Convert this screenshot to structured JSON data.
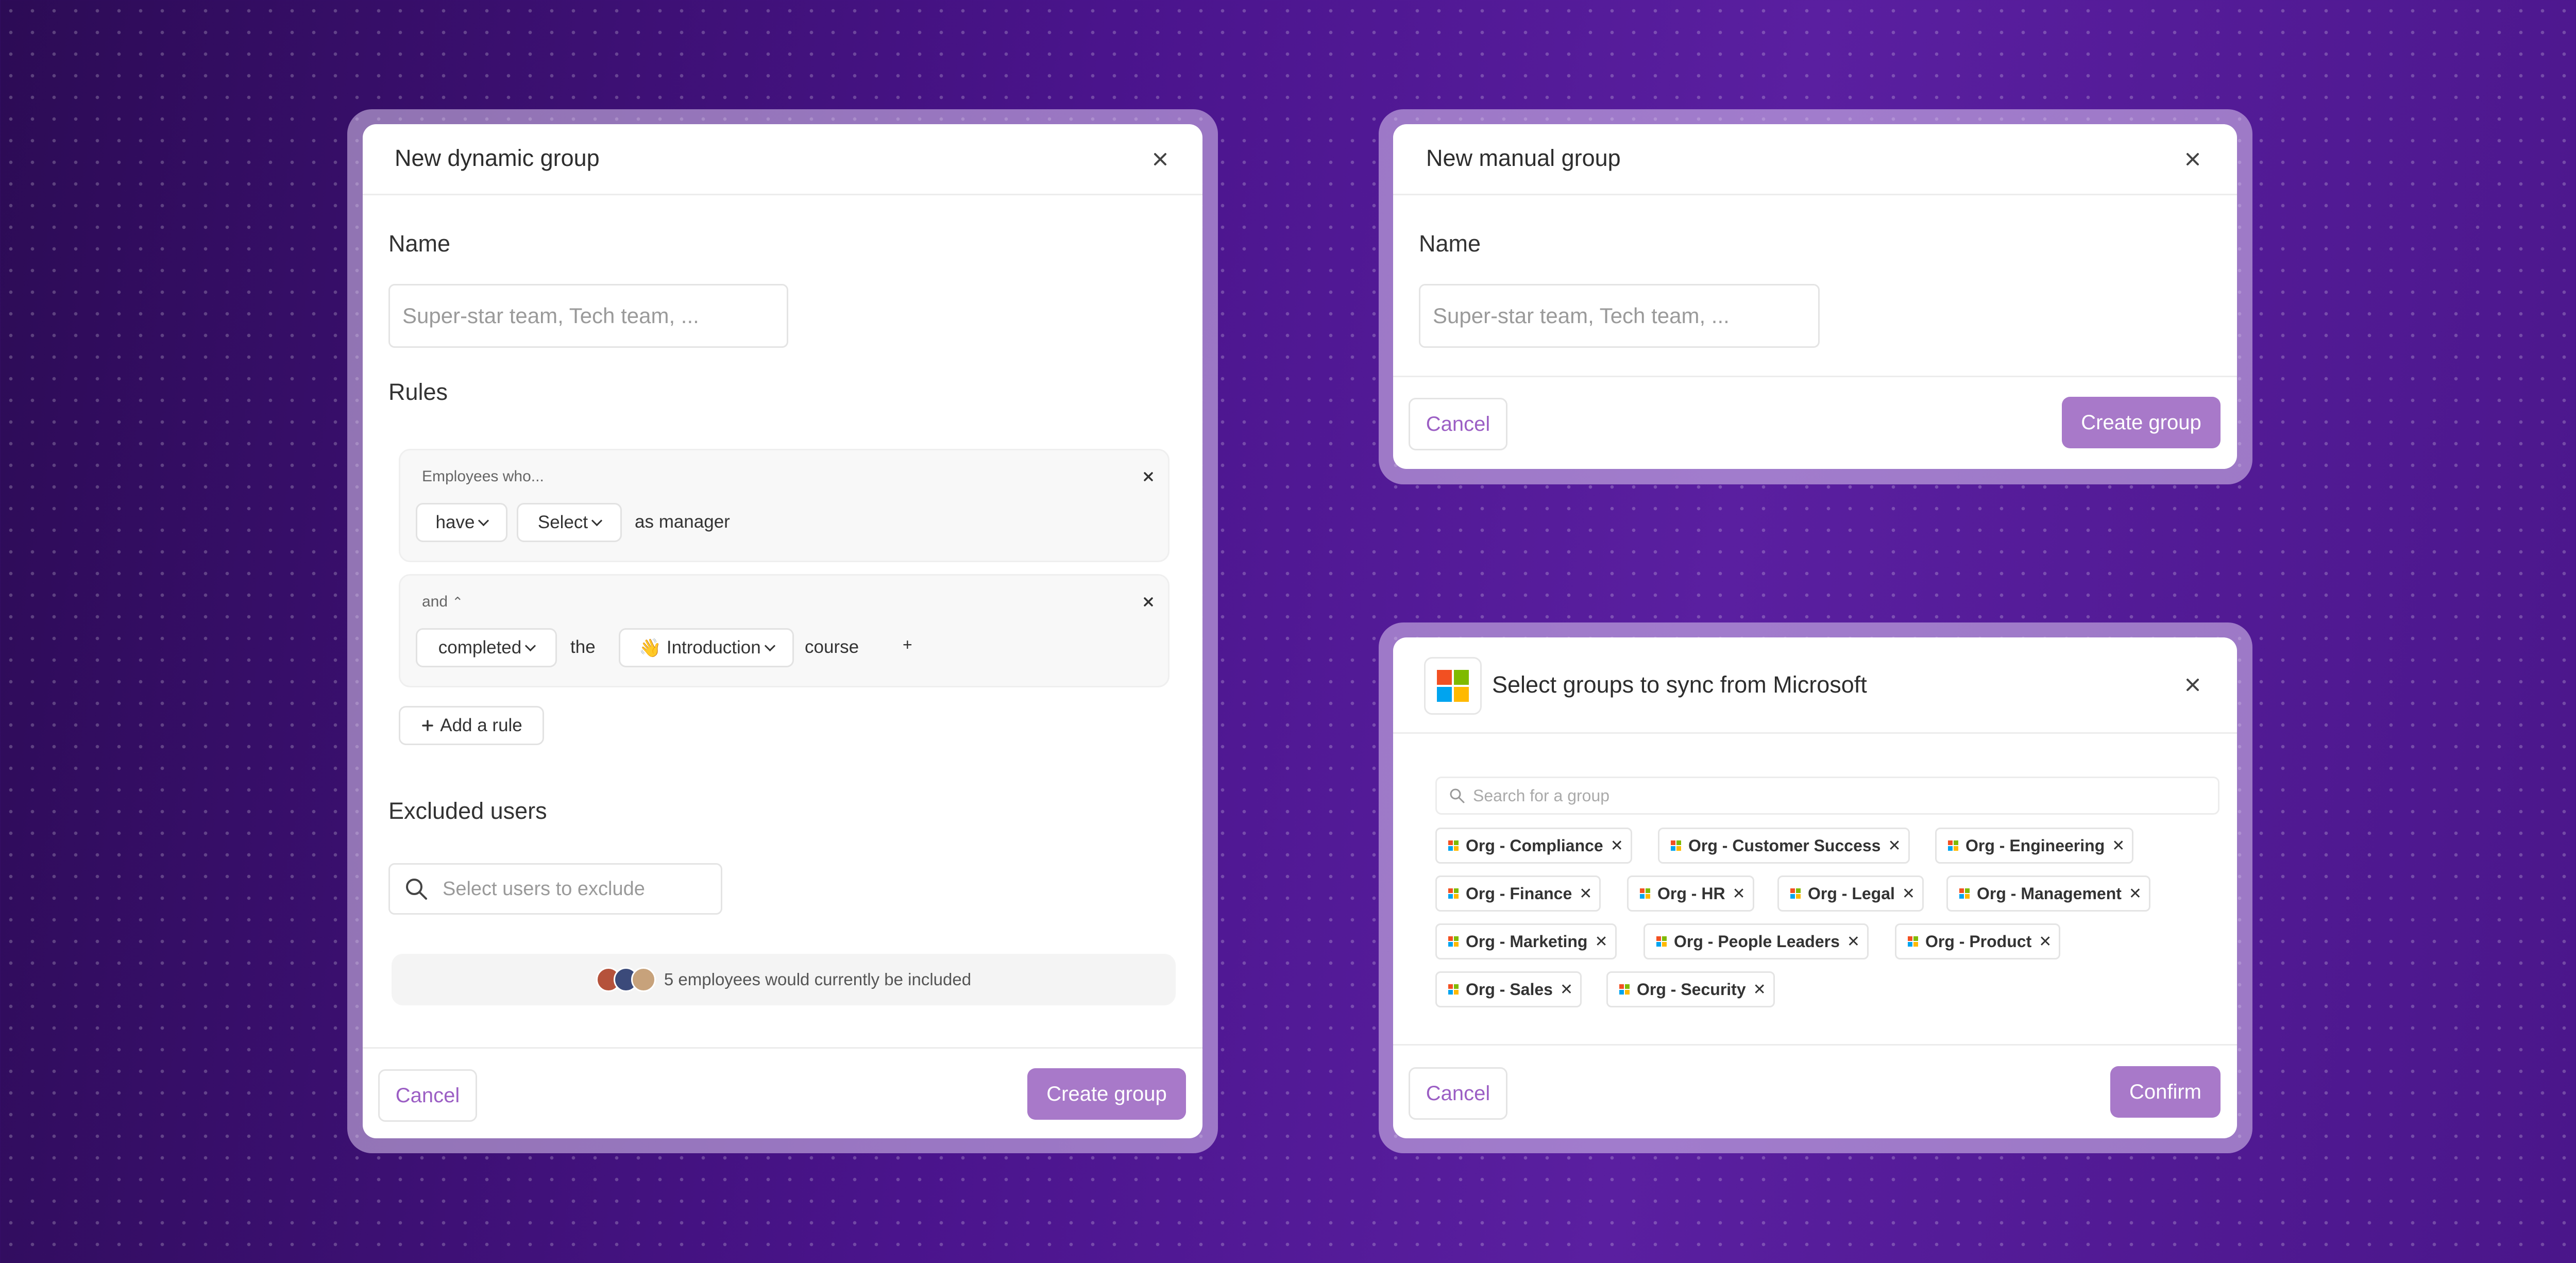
{
  "dynamic_group": {
    "title": "New dynamic group",
    "name_label": "Name",
    "name_placeholder": "Super-star team, Tech team, ...",
    "rules_label": "Rules",
    "rule1": {
      "heading": "Employees who...",
      "verb": "have",
      "select": "Select",
      "suffix": "as manager"
    },
    "rule2": {
      "connector": "and",
      "status": "completed",
      "word_the": "the",
      "course_emoji": "👋",
      "course": "Introduction",
      "word_course": "course",
      "plus": "+"
    },
    "add_rule": "Add a rule",
    "excluded_label": "Excluded users",
    "exclude_placeholder": "Select users to exclude",
    "included_text": "5 employees would currently be included",
    "cancel": "Cancel",
    "create": "Create group"
  },
  "manual_group": {
    "title": "New manual group",
    "name_label": "Name",
    "name_placeholder": "Super-star team, Tech team, ...",
    "cancel": "Cancel",
    "create": "Create group"
  },
  "microsoft_sync": {
    "title": "Select groups to sync from Microsoft",
    "search_placeholder": "Search for a group",
    "groups": [
      "Org - Compliance",
      "Org - Customer Success",
      "Org - Engineering",
      "Org - Finance",
      "Org - HR",
      "Org - Legal",
      "Org - Management",
      "Org - Marketing",
      "Org - People Leaders",
      "Org - Product",
      "Org - Sales",
      "Org - Security"
    ],
    "cancel": "Cancel",
    "confirm": "Confirm"
  },
  "colors": {
    "accent": "#a879c9",
    "accent_text": "#9b5ec4",
    "ms_red": "#f25022",
    "ms_green": "#7fba00",
    "ms_blue": "#00a4ef",
    "ms_yellow": "#ffb900"
  },
  "icons": {
    "close": "close-icon",
    "search": "search-icon",
    "chevron": "chevron-down-icon",
    "plus": "plus-icon",
    "logo": "microsoft-logo-icon"
  }
}
